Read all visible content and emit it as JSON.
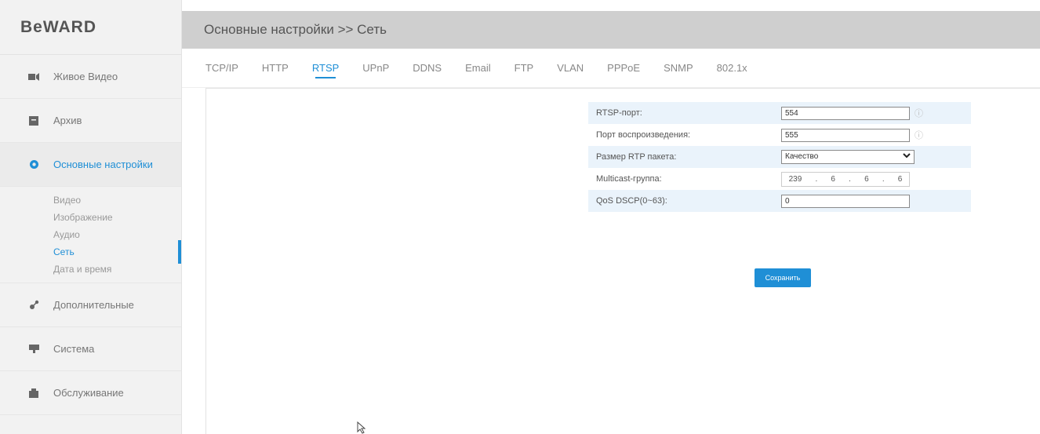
{
  "brand": {
    "logo": "BeWARD"
  },
  "sidebar": {
    "items": [
      {
        "label": "Живое Видео",
        "icon": "video-camera-icon"
      },
      {
        "label": "Архив",
        "icon": "archive-icon"
      },
      {
        "label": "Основные настройки",
        "icon": "gear-icon"
      }
    ],
    "subitems": [
      "Видео",
      "Изображение",
      "Аудио",
      "Сеть",
      "Дата и время"
    ],
    "bottom_items": [
      {
        "label": "Дополнительные",
        "icon": "advanced-settings-icon"
      },
      {
        "label": "Система",
        "icon": "system-icon"
      },
      {
        "label": "Обслуживание",
        "icon": "maintenance-icon"
      }
    ]
  },
  "header": {
    "breadcrumb": "Основные настройки >> Сеть"
  },
  "tabs": [
    "TCP/IP",
    "HTTP",
    "RTSP",
    "UPnP",
    "DDNS",
    "Email",
    "FTP",
    "VLAN",
    "PPPoE",
    "SNMP",
    "802.1x"
  ],
  "form": {
    "rtsp_port_label": "RTSP-порт:",
    "rtsp_port_value": "554",
    "playback_port_label": "Порт воспроизведения:",
    "playback_port_value": "555",
    "rtp_size_label": "Размер RTP пакета:",
    "rtp_size_value": "Качество",
    "multicast_label": "Multicast-группа:",
    "multicast_octets": [
      "239",
      "6",
      "6",
      "6"
    ],
    "qos_label": "QoS DSCP(0~63):",
    "qos_value": "0",
    "info_glyph": "ⓘ"
  },
  "actions": {
    "save_label": "Сохранить"
  },
  "colors": {
    "accent": "#1f8fd6",
    "topbar": "#cfcfcf",
    "sidebar": "#f2f2f2",
    "row_shade": "#eaf3fb"
  }
}
